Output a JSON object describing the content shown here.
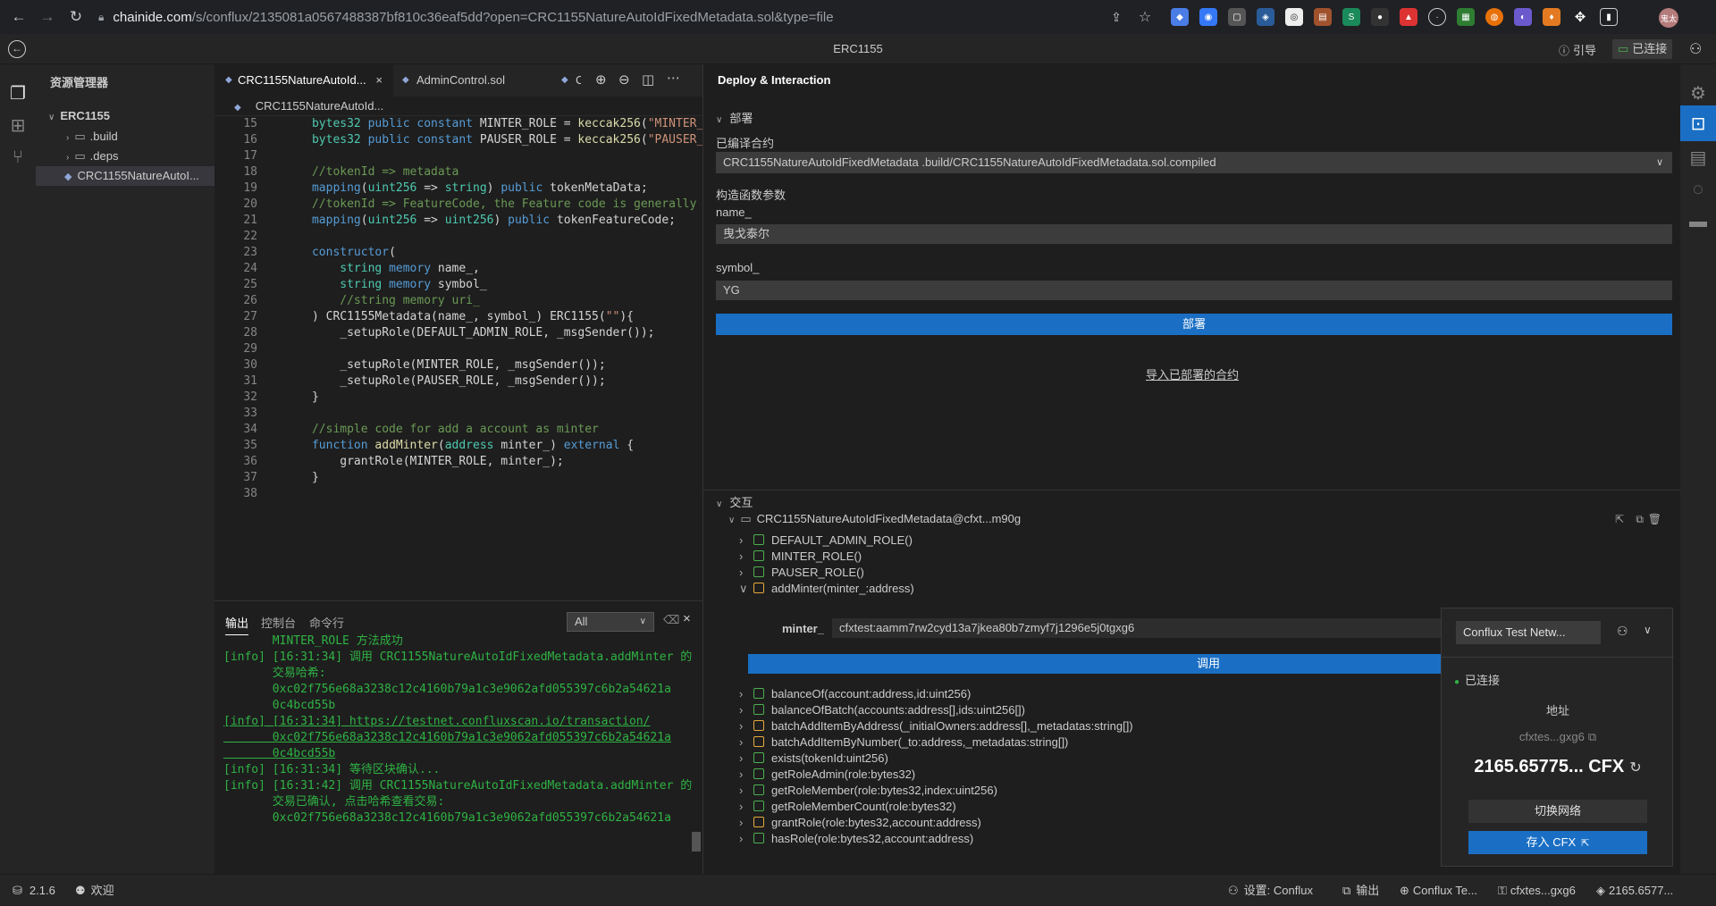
{
  "browser": {
    "url_host": "chainide.com",
    "url_path": "/s/conflux/2135081a0567488387bf810c36eaf5dd?open=CRC1155NatureAutoIdFixedMetadata.sol&type=file",
    "profile_label": "鬼太"
  },
  "titlebar": {
    "title": "ERC1155",
    "guide_label": "引导",
    "connected_label": "已连接"
  },
  "explorer": {
    "header": "资源管理器",
    "root": "ERC1155",
    "items": [
      ".build",
      ".deps",
      "CRC1155NatureAutoI..."
    ]
  },
  "editor": {
    "tabs": [
      "CRC1155NatureAutoId...",
      "AdminControl.sol",
      "C"
    ],
    "breadcrumb": "CRC1155NatureAutoId...",
    "lines": [
      {
        "n": "15",
        "parts": [
          [
            "ty",
            "bytes32"
          ],
          [
            "kw",
            " public constant "
          ],
          [
            "id",
            "MINTER_ROLE = "
          ],
          [
            "fn",
            "keccak256"
          ],
          [
            "id",
            "("
          ],
          [
            "st",
            "\"MINTER_"
          ]
        ]
      },
      {
        "n": "16",
        "parts": [
          [
            "ty",
            "bytes32"
          ],
          [
            "kw",
            " public constant "
          ],
          [
            "id",
            "PAUSER_ROLE = "
          ],
          [
            "fn",
            "keccak256"
          ],
          [
            "id",
            "("
          ],
          [
            "st",
            "\"PAUSER_"
          ]
        ]
      },
      {
        "n": "17",
        "parts": []
      },
      {
        "n": "18",
        "parts": [
          [
            "cm",
            "//tokenId => metadata"
          ]
        ]
      },
      {
        "n": "19",
        "parts": [
          [
            "kw",
            "mapping"
          ],
          [
            "id",
            "("
          ],
          [
            "ty",
            "uint256"
          ],
          [
            "id",
            " => "
          ],
          [
            "ty",
            "string"
          ],
          [
            "id",
            ") "
          ],
          [
            "kw",
            "public"
          ],
          [
            "id",
            " tokenMetaData;"
          ]
        ]
      },
      {
        "n": "20",
        "parts": [
          [
            "cm",
            "//tokenId => FeatureCode, the Feature code is generally"
          ]
        ]
      },
      {
        "n": "21",
        "parts": [
          [
            "kw",
            "mapping"
          ],
          [
            "id",
            "("
          ],
          [
            "ty",
            "uint256"
          ],
          [
            "id",
            " => "
          ],
          [
            "ty",
            "uint256"
          ],
          [
            "id",
            ") "
          ],
          [
            "kw",
            "public"
          ],
          [
            "id",
            " tokenFeatureCode;"
          ]
        ]
      },
      {
        "n": "22",
        "parts": []
      },
      {
        "n": "23",
        "parts": [
          [
            "kw",
            "constructor"
          ],
          [
            "id",
            "("
          ]
        ]
      },
      {
        "n": "24",
        "parts": [
          [
            "id",
            "    "
          ],
          [
            "ty",
            "string"
          ],
          [
            "kw",
            " memory"
          ],
          [
            "id",
            " name_,"
          ]
        ]
      },
      {
        "n": "25",
        "parts": [
          [
            "id",
            "    "
          ],
          [
            "ty",
            "string"
          ],
          [
            "kw",
            " memory"
          ],
          [
            "id",
            " symbol_"
          ]
        ]
      },
      {
        "n": "26",
        "parts": [
          [
            "cm",
            "    //string memory uri_"
          ]
        ]
      },
      {
        "n": "27",
        "parts": [
          [
            "id",
            ") CRC1155Metadata(name_, symbol_) ERC1155("
          ],
          [
            "st",
            "\"\""
          ],
          [
            "id",
            "){"
          ]
        ]
      },
      {
        "n": "28",
        "parts": [
          [
            "id",
            "    _setupRole(DEFAULT_ADMIN_ROLE, _msgSender());"
          ]
        ]
      },
      {
        "n": "29",
        "parts": []
      },
      {
        "n": "30",
        "parts": [
          [
            "id",
            "    _setupRole(MINTER_ROLE, _msgSender());"
          ]
        ]
      },
      {
        "n": "31",
        "parts": [
          [
            "id",
            "    _setupRole(PAUSER_ROLE, _msgSender());"
          ]
        ]
      },
      {
        "n": "32",
        "parts": [
          [
            "id",
            "}"
          ]
        ]
      },
      {
        "n": "33",
        "parts": []
      },
      {
        "n": "34",
        "parts": [
          [
            "cm",
            "//simple code for add a account as minter"
          ]
        ]
      },
      {
        "n": "35",
        "parts": [
          [
            "kw",
            "function"
          ],
          [
            "fn",
            " addMinter"
          ],
          [
            "id",
            "("
          ],
          [
            "ty",
            "address"
          ],
          [
            "id",
            " minter_) "
          ],
          [
            "kw",
            "external"
          ],
          [
            "id",
            " {"
          ]
        ]
      },
      {
        "n": "36",
        "parts": [
          [
            "id",
            "    grantRole(MINTER_ROLE, minter_);"
          ]
        ]
      },
      {
        "n": "37",
        "parts": [
          [
            "id",
            "}"
          ]
        ]
      },
      {
        "n": "38",
        "parts": []
      }
    ]
  },
  "output": {
    "tabs": [
      "输出",
      "控制台",
      "命令行"
    ],
    "filter": "All",
    "lines": [
      {
        "text": "       MINTER_ROLE 方法成功",
        "link": false
      },
      {
        "text": "[info] [16:31:34] 调用 CRC1155NatureAutoIdFixedMetadata.addMinter 的",
        "link": false
      },
      {
        "text": "       交易哈希:",
        "link": false
      },
      {
        "text": "       0xc02f756e68a3238c12c4160b79a1c3e9062afd055397c6b2a54621a",
        "link": false
      },
      {
        "text": "       0c4bcd55b",
        "link": false
      },
      {
        "text": "[info] [16:31:34] https://testnet.confluxscan.io/transaction/",
        "link": true
      },
      {
        "text": "       0xc02f756e68a3238c12c4160b79a1c3e9062afd055397c6b2a54621a",
        "link": true
      },
      {
        "text": "       0c4bcd55b",
        "link": true
      },
      {
        "text": "[info] [16:31:34] 等待区块确认...",
        "link": false
      },
      {
        "text": "[info] [16:31:42] 调用 CRC1155NatureAutoIdFixedMetadata.addMinter 的",
        "link": false
      },
      {
        "text": "       交易已确认, 点击哈希查看交易:",
        "link": false
      },
      {
        "text": "       0xc02f756e68a3238c12c4160b79a1c3e9062afd055397c6b2a54621a",
        "link": false
      }
    ]
  },
  "deploy": {
    "header": "Deploy & Interaction",
    "section_deploy": "部署",
    "compiled_label": "已编译合约",
    "compiled_value": "CRC1155NatureAutoIdFixedMetadata .build/CRC1155NatureAutoIdFixedMetadata.sol.compiled",
    "ctor_label": "构造函数参数",
    "name_label": "name_",
    "name_value": "曳戈泰尔",
    "symbol_label": "symbol_",
    "symbol_value": "YG",
    "deploy_button": "部署",
    "import_link": "导入已部署的合约",
    "section_interact": "交互",
    "contract_instance": "CRC1155NatureAutoIdFixedMetadata@cfxt...m90g",
    "functions_top": [
      {
        "name": "DEFAULT_ADMIN_ROLE()",
        "kind": "view",
        "open": false
      },
      {
        "name": "MINTER_ROLE()",
        "kind": "view",
        "open": false
      },
      {
        "name": "PAUSER_ROLE()",
        "kind": "view",
        "open": false
      },
      {
        "name": "addMinter(minter_:address)",
        "kind": "write",
        "open": true
      }
    ],
    "minter_label": "minter_",
    "minter_value": "cfxtest:aamm7rw2cyd13a7jkea80b7zmyf7j1296e5j0tgxg6",
    "call_button": "调用",
    "functions_bottom": [
      {
        "name": "balanceOf(account:address,id:uint256)",
        "kind": "view"
      },
      {
        "name": "balanceOfBatch(accounts:address[],ids:uint256[])",
        "kind": "view"
      },
      {
        "name": "batchAddItemByAddress(_initialOwners:address[],_metadatas:string[])",
        "kind": "write"
      },
      {
        "name": "batchAddItemByNumber(_to:address,_metadatas:string[])",
        "kind": "write"
      },
      {
        "name": "exists(tokenId:uint256)",
        "kind": "view"
      },
      {
        "name": "getRoleAdmin(role:bytes32)",
        "kind": "view"
      },
      {
        "name": "getRoleMember(role:bytes32,index:uint256)",
        "kind": "view"
      },
      {
        "name": "getRoleMemberCount(role:bytes32)",
        "kind": "view"
      },
      {
        "name": "grantRole(role:bytes32,account:address)",
        "kind": "write"
      },
      {
        "name": "hasRole(role:bytes32,account:address)",
        "kind": "view"
      }
    ]
  },
  "wallet": {
    "network": "Conflux Test Netw...",
    "status": "已连接",
    "address_label": "地址",
    "address": "cfxtes...gxg6",
    "balance": "2165.65775... CFX",
    "switch_network": "切换网络",
    "deposit": "存入 CFX"
  },
  "statusbar": {
    "version": "2.1.6",
    "welcome": "欢迎",
    "settings": "设置:",
    "settings_value": "Conflux",
    "output": "输出",
    "network": "Conflux Te...",
    "account": "cfxtes...gxg6",
    "balance": "2165.6577..."
  },
  "colors": {
    "accent": "#1a6fc4",
    "success": "#2fb344",
    "bg": "#1e1e1e",
    "panel": "#252526"
  }
}
